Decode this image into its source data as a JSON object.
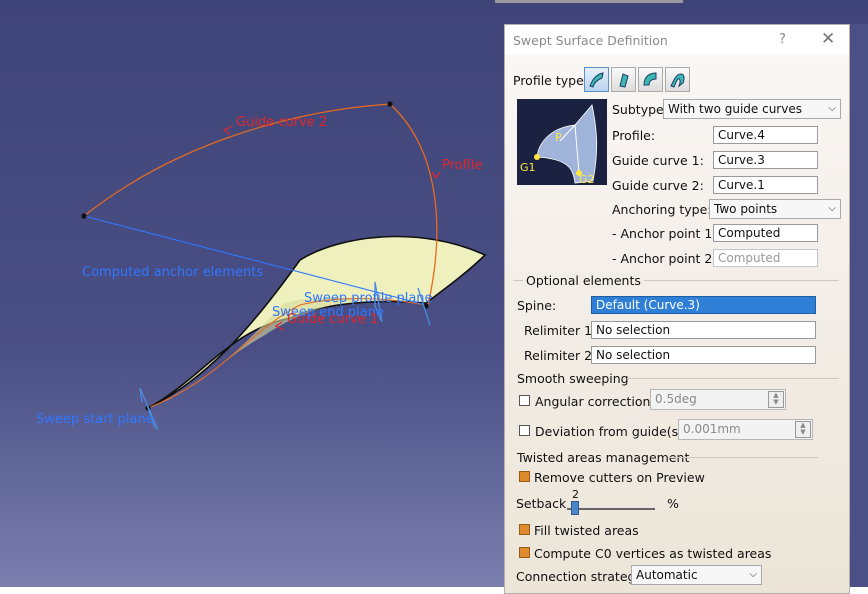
{
  "viewport": {
    "labels": {
      "guide_curve_2": "Guide curve 2",
      "profile": "Profile",
      "computed_anchor": "Computed anchor elements",
      "sweep_profile_plane": "Sweep profile plane",
      "sweep_end_plane": "Sweep end plane",
      "guide_curve_1": "Guide curve 1",
      "sweep_start_plane": "Sweep start plane"
    },
    "colors": {
      "background": "#444a80",
      "surface": "#f1f2c4",
      "guide": "#e96a1d",
      "anchor_line": "#2f78ff",
      "plane": "#4b8be0"
    }
  },
  "dialog": {
    "title": "Swept Surface Definition",
    "help_glyph": "?",
    "close_glyph": "✕",
    "profile_type_label": "Profile type:",
    "profile_type_buttons": [
      "explicit-profile-icon",
      "line-profile-icon",
      "circle-profile-icon",
      "conic-profile-icon"
    ],
    "preview": {
      "point_p": "P",
      "point_g1": "G1",
      "point_g2": "G2"
    },
    "subtype_label": "Subtype:",
    "subtype_value": "With two guide curves",
    "profile_label": "Profile:",
    "profile_value": "Curve.4",
    "guide1_label": "Guide curve 1:",
    "guide1_value": "Curve.3",
    "guide2_label": "Guide curve 2:",
    "guide2_value": "Curve.1",
    "anchoring_label": "Anchoring type:",
    "anchoring_value": "Two points",
    "anchor1_label": "- Anchor point 1:",
    "anchor1_value": "Computed",
    "anchor2_label": "- Anchor point 2:",
    "anchor2_value": "Computed",
    "optional_title": "Optional elements",
    "spine_label": "Spine:",
    "spine_value": "Default (Curve.3)",
    "relim1_label": "Relimiter 1:",
    "relim1_value": "No selection",
    "relim2_label": "Relimiter 2:",
    "relim2_value": "No selection",
    "smooth_title": "Smooth sweeping",
    "angular_label": "Angular correction:",
    "angular_value": "0.5deg",
    "deviation_label": "Deviation from guide(s):",
    "deviation_value": "0.001mm",
    "twisted_title": "Twisted areas management",
    "remove_cutters_label": "Remove cutters on Preview",
    "setback_label": "Setback",
    "setback_value": "2",
    "setback_unit": "%",
    "setback_level": 2,
    "fill_twisted_label": "Fill twisted areas",
    "compute_c0_label": "Compute C0 vertices as twisted areas",
    "connection_label": "Connection strategy:",
    "connection_value": "Automatic"
  }
}
